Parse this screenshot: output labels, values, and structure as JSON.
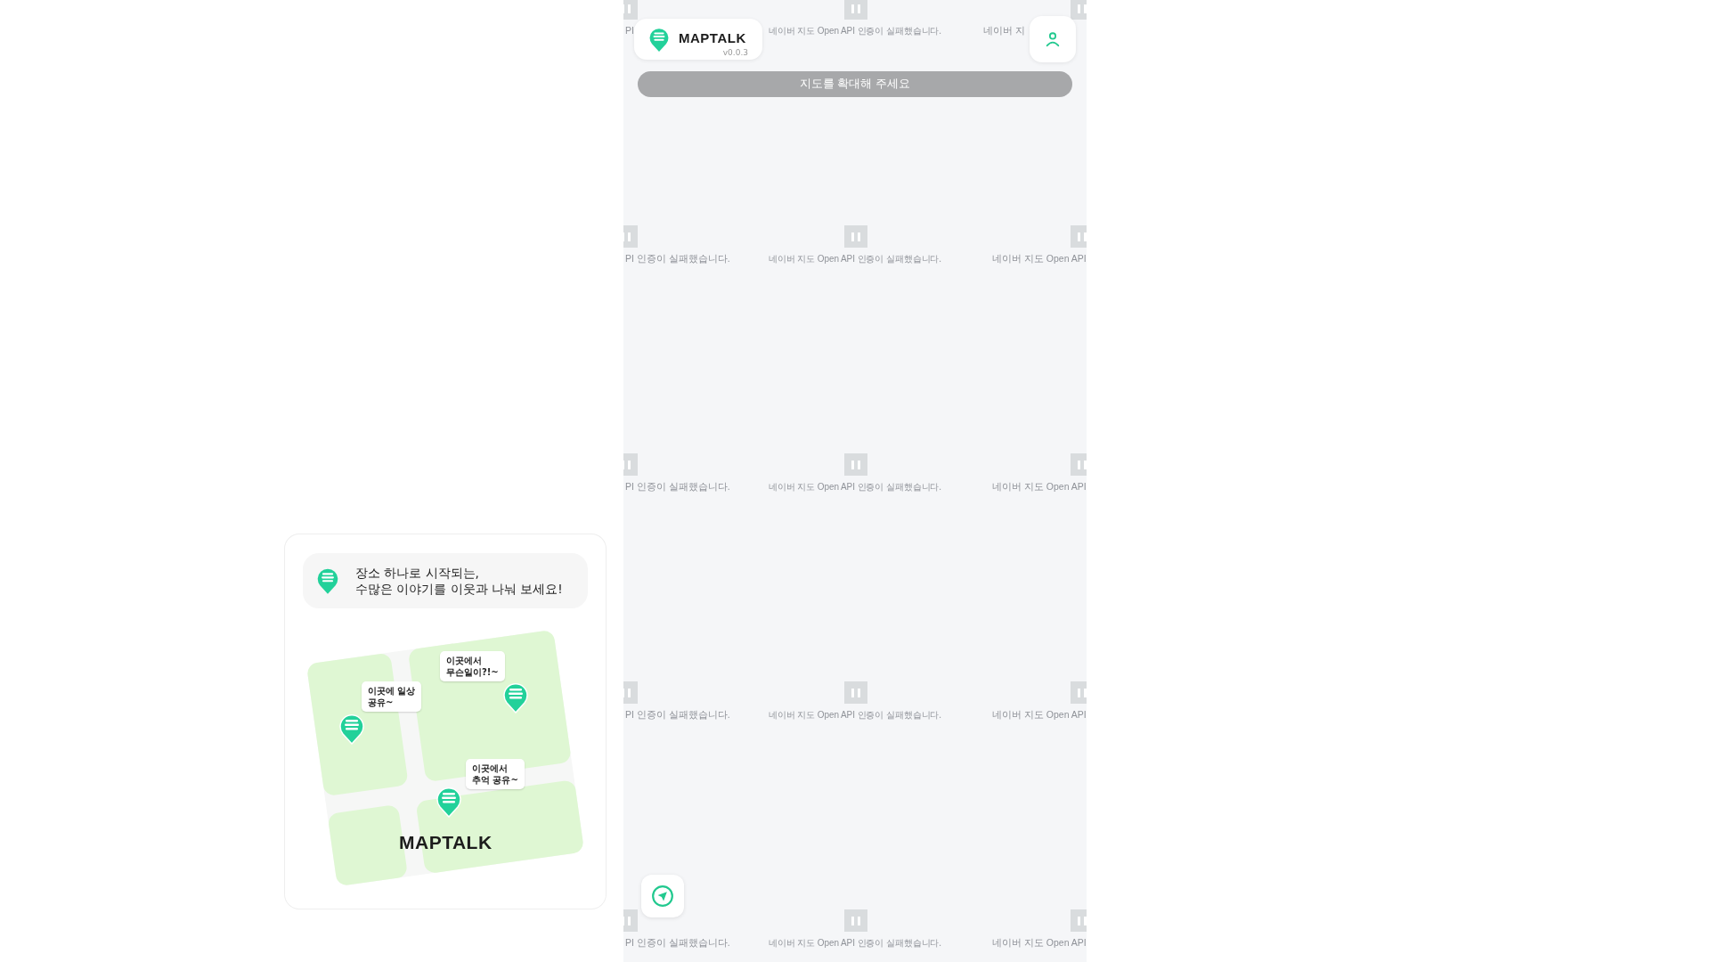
{
  "promo": {
    "headline": "장소 하나로 시작되는,\n수많은 이야기를 이웃과 나눠 보세요!",
    "bubbles": [
      {
        "text": "이곳에 일상\n공유~"
      },
      {
        "text": "이곳에서\n무슨일이?!~"
      },
      {
        "text": "이곳에서\n추억 공유~"
      }
    ],
    "wordmark": "MAPTALK"
  },
  "map": {
    "tile_rows": [
      {
        "left": "PI",
        "center": "네이버 지도 Open API 인증이 실패했습니다.",
        "right": "네이버 지"
      },
      {
        "left": "PI 인증이 실패했습니다.",
        "center": "네이버 지도 Open API 인증이 실패했습니다.",
        "right": "네이버 지도 Open API"
      },
      {
        "left": "PI 인증이 실패했습니다.",
        "center": "네이버 지도 Open API 인증이 실패했습니다.",
        "right": "네이버 지도 Open API"
      },
      {
        "left": "PI 인증이 실패했습니다.",
        "center": "네이버 지도 Open API 인증이 실패했습니다.",
        "right": "네이버 지도 Open API"
      },
      {
        "left": "PI 인증이 실패했습니다.",
        "center": "네이버 지도 Open API 인증이 실패했습니다.",
        "right": "네이버 지도 Open API"
      }
    ],
    "logo": {
      "name": "MAPTALK",
      "version": "v0.0.3"
    },
    "zoom_notice": "지도를 확대해 주세요"
  }
}
